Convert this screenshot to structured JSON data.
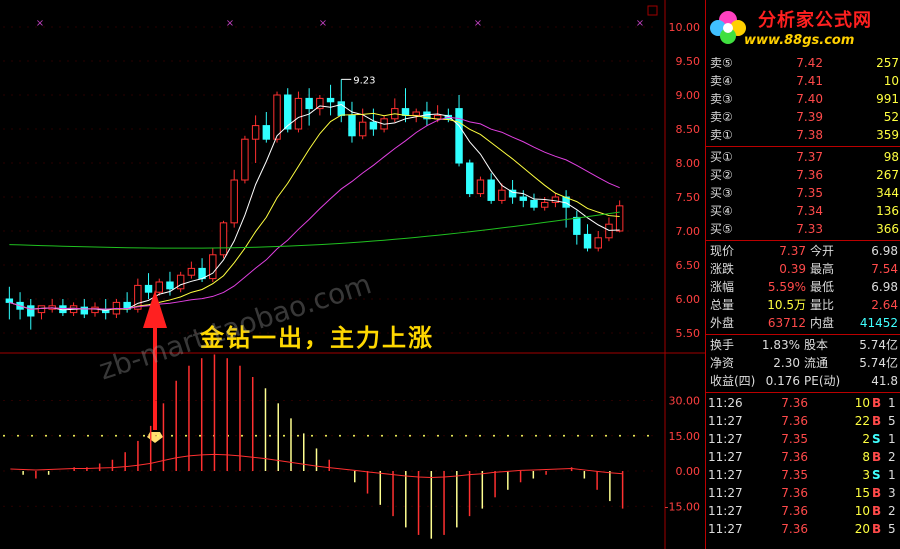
{
  "chart_data": {
    "type": "candlestick",
    "y_ticks": [
      "10.00",
      "9.50",
      "9.00",
      "8.50",
      "8.00",
      "7.50",
      "7.00",
      "6.50",
      "6.00",
      "5.50"
    ],
    "y_min": 5.25,
    "y_max": 10.25,
    "peak_label": "9.23",
    "candles": [
      [
        6.0,
        6.18,
        5.95,
        5.7
      ],
      [
        5.95,
        6.1,
        5.85,
        5.7
      ],
      [
        5.9,
        6.0,
        5.75,
        5.55
      ],
      [
        5.8,
        5.9,
        5.9,
        5.7
      ],
      [
        5.85,
        6.0,
        5.9,
        5.8
      ],
      [
        5.9,
        6.0,
        5.8,
        5.75
      ],
      [
        5.8,
        5.95,
        5.9,
        5.75
      ],
      [
        5.88,
        6.0,
        5.78,
        5.72
      ],
      [
        5.8,
        5.95,
        5.88,
        5.74
      ],
      [
        5.85,
        6.0,
        5.8,
        5.7
      ],
      [
        5.78,
        6.0,
        5.95,
        5.72
      ],
      [
        5.95,
        6.1,
        5.85,
        5.8
      ],
      [
        5.85,
        6.3,
        6.2,
        5.8
      ],
      [
        6.2,
        6.38,
        6.1,
        6.0
      ],
      [
        6.1,
        6.3,
        6.25,
        6.05
      ],
      [
        6.25,
        6.4,
        6.15,
        6.05
      ],
      [
        6.15,
        6.4,
        6.35,
        6.1
      ],
      [
        6.35,
        6.55,
        6.45,
        6.3
      ],
      [
        6.45,
        6.6,
        6.3,
        6.25
      ],
      [
        6.3,
        6.75,
        6.65,
        6.25
      ],
      [
        6.65,
        7.15,
        7.12,
        6.6
      ],
      [
        7.12,
        7.9,
        7.75,
        7.05
      ],
      [
        7.75,
        8.4,
        8.35,
        7.7
      ],
      [
        8.35,
        8.7,
        8.55,
        8.0
      ],
      [
        8.55,
        8.75,
        8.35,
        8.3
      ],
      [
        8.35,
        9.05,
        9.0,
        8.3
      ],
      [
        9.0,
        9.1,
        8.5,
        8.45
      ],
      [
        8.5,
        9.05,
        8.95,
        8.45
      ],
      [
        8.95,
        9.1,
        8.8,
        8.55
      ],
      [
        8.8,
        9.0,
        8.95,
        8.7
      ],
      [
        8.95,
        9.15,
        8.9,
        8.7
      ],
      [
        8.9,
        9.23,
        8.7,
        8.6
      ],
      [
        8.7,
        8.9,
        8.4,
        8.3
      ],
      [
        8.4,
        8.8,
        8.6,
        8.35
      ],
      [
        8.6,
        8.8,
        8.5,
        8.4
      ],
      [
        8.5,
        8.7,
        8.65,
        8.45
      ],
      [
        8.65,
        8.95,
        8.8,
        8.6
      ],
      [
        8.8,
        9.1,
        8.7,
        8.6
      ],
      [
        8.7,
        8.8,
        8.75,
        8.6
      ],
      [
        8.75,
        8.9,
        8.65,
        8.55
      ],
      [
        8.65,
        8.85,
        8.7,
        8.6
      ],
      [
        8.7,
        8.8,
        8.65,
        8.6
      ],
      [
        8.8,
        9.0,
        8.0,
        7.95
      ],
      [
        8.0,
        8.05,
        7.55,
        7.5
      ],
      [
        7.55,
        7.8,
        7.75,
        7.5
      ],
      [
        7.75,
        7.85,
        7.45,
        7.4
      ],
      [
        7.45,
        7.7,
        7.6,
        7.4
      ],
      [
        7.6,
        7.75,
        7.5,
        7.4
      ],
      [
        7.5,
        7.6,
        7.45,
        7.35
      ],
      [
        7.45,
        7.55,
        7.35,
        7.3
      ],
      [
        7.35,
        7.5,
        7.42,
        7.3
      ],
      [
        7.42,
        7.55,
        7.5,
        7.35
      ],
      [
        7.5,
        7.6,
        7.35,
        7.05
      ],
      [
        7.2,
        7.3,
        6.95,
        6.8
      ],
      [
        6.95,
        7.1,
        6.75,
        6.7
      ],
      [
        6.75,
        7.0,
        6.9,
        6.7
      ],
      [
        6.9,
        7.2,
        7.1,
        6.85
      ],
      [
        7.0,
        7.45,
        7.37,
        6.98
      ]
    ],
    "macd": [
      0,
      -1,
      -2,
      -1,
      0,
      1,
      1,
      2,
      3,
      5,
      8,
      12,
      18,
      24,
      28,
      30,
      31,
      30,
      28,
      25,
      22,
      18,
      14,
      10,
      6,
      3,
      0,
      -3,
      -6,
      -9,
      -12,
      -15,
      -17,
      -18,
      -17,
      -15,
      -12,
      -10,
      -7,
      -5,
      -3,
      -2,
      -1,
      0,
      1,
      -2,
      -5,
      -8,
      -10
    ]
  },
  "macd_ticks": [
    "30.00",
    "15.00",
    "0.00",
    "-15.00"
  ],
  "annotation": "金钻一出，主力上涨",
  "watermark": "zb-mart.taobao.com",
  "logo": {
    "name": "分析家公式网",
    "url": "www.88gs.com"
  },
  "order_book": {
    "sell": [
      {
        "label": "卖⑤",
        "price": "7.42",
        "vol": "257"
      },
      {
        "label": "卖④",
        "price": "7.41",
        "vol": "10"
      },
      {
        "label": "卖③",
        "price": "7.40",
        "vol": "991"
      },
      {
        "label": "卖②",
        "price": "7.39",
        "vol": "52"
      },
      {
        "label": "卖①",
        "price": "7.38",
        "vol": "359"
      }
    ],
    "buy": [
      {
        "label": "买①",
        "price": "7.37",
        "vol": "98"
      },
      {
        "label": "买②",
        "price": "7.36",
        "vol": "267"
      },
      {
        "label": "买③",
        "price": "7.35",
        "vol": "344"
      },
      {
        "label": "买④",
        "price": "7.34",
        "vol": "136"
      },
      {
        "label": "买⑤",
        "price": "7.33",
        "vol": "366"
      }
    ]
  },
  "quote": [
    {
      "l1": "现价",
      "v1": "7.37",
      "c1": "#ff4a4a",
      "l2": "今开",
      "v2": "6.98",
      "c2": "#ddd"
    },
    {
      "l1": "涨跌",
      "v1": "0.39",
      "c1": "#ff4a4a",
      "l2": "最高",
      "v2": "7.54",
      "c2": "#ff4a4a"
    },
    {
      "l1": "涨幅",
      "v1": "5.59%",
      "c1": "#ff4a4a",
      "l2": "最低",
      "v2": "6.98",
      "c2": "#ddd"
    },
    {
      "l1": "总量",
      "v1": "10.5万",
      "c1": "#ffff40",
      "l2": "量比",
      "v2": "2.64",
      "c2": "#ff4a4a"
    },
    {
      "l1": "外盘",
      "v1": "63712",
      "c1": "#ff4a4a",
      "l2": "内盘",
      "v2": "41452",
      "c2": "#40ffff"
    }
  ],
  "stats": [
    {
      "l1": "换手",
      "v1": "1.83%",
      "l2": "股本",
      "v2": "5.74亿"
    },
    {
      "l1": "净资",
      "v1": "2.30",
      "l2": "流通",
      "v2": "5.74亿"
    },
    {
      "l1": "收益(四)",
      "v1": "0.176",
      "l2": "PE(动)",
      "v2": "41.8"
    }
  ],
  "ticks": [
    {
      "time": "11:26",
      "price": "7.36",
      "vol": "10",
      "side": "B",
      "n": "1"
    },
    {
      "time": "11:27",
      "price": "7.36",
      "vol": "22",
      "side": "B",
      "n": "5"
    },
    {
      "time": "11:27",
      "price": "7.35",
      "vol": "2",
      "side": "S",
      "n": "1"
    },
    {
      "time": "11:27",
      "price": "7.36",
      "vol": "8",
      "side": "B",
      "n": "2"
    },
    {
      "time": "11:27",
      "price": "7.35",
      "vol": "3",
      "side": "S",
      "n": "1"
    },
    {
      "time": "11:27",
      "price": "7.36",
      "vol": "15",
      "side": "B",
      "n": "3"
    },
    {
      "time": "11:27",
      "price": "7.36",
      "vol": "10",
      "side": "B",
      "n": "2"
    },
    {
      "time": "11:27",
      "price": "7.36",
      "vol": "20",
      "side": "B",
      "n": "5"
    }
  ],
  "colors": {
    "up": "#ff3030",
    "down": "#30ffff",
    "ma5": "#ffffff",
    "ma10": "#ffff40",
    "ma20": "#e040e0",
    "ma60": "#20c020",
    "grid": "#a00000",
    "macd_line": "#ff3030"
  }
}
